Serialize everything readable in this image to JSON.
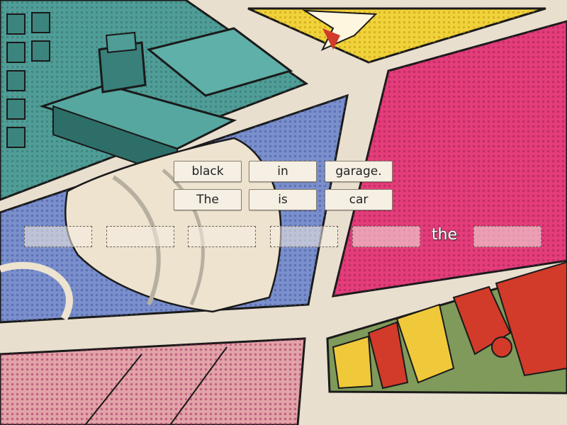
{
  "tiles": [
    "black",
    "in",
    "garage.",
    "The",
    "is",
    "car"
  ],
  "sentence": {
    "fixed_word": "the"
  },
  "colors": {
    "paper": "#e9dfcf",
    "teal": "#4a9b98",
    "blue": "#6f86c4",
    "magenta": "#e43d7a",
    "yellow": "#f0d23a",
    "red": "#d23a2a",
    "ink": "#1a1a1a"
  }
}
